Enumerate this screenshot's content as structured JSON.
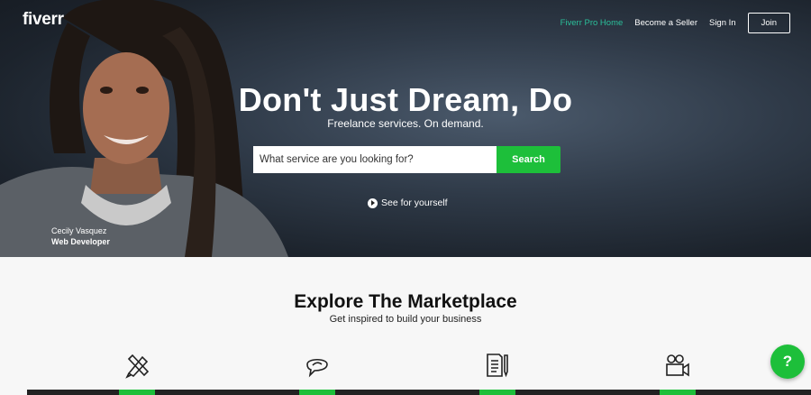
{
  "brand": {
    "logo": "fiverr"
  },
  "nav": {
    "pro_home": "Fiverr Pro Home",
    "become_seller": "Become a Seller",
    "sign_in": "Sign In",
    "join": "Join"
  },
  "hero": {
    "headline": "Don't Just Dream, Do",
    "subline": "Freelance services. On demand.",
    "caption_name": "Cecily Vasquez",
    "caption_role": "Web Developer",
    "see_label": "See for yourself"
  },
  "search": {
    "placeholder": "What service are you looking for?",
    "button_label": "Search"
  },
  "explore": {
    "title": "Explore The Marketplace",
    "subtitle": "Get inspired to build your business",
    "categories": [
      {
        "icon": "graphics-design-icon"
      },
      {
        "icon": "digital-marketing-icon"
      },
      {
        "icon": "writing-translation-icon"
      },
      {
        "icon": "video-animation-icon"
      }
    ]
  },
  "help": {
    "label": "?"
  },
  "colors": {
    "accent": "#1dbf3a",
    "pro": "#2bbf9a",
    "hero_bg": "#2f3a48"
  }
}
